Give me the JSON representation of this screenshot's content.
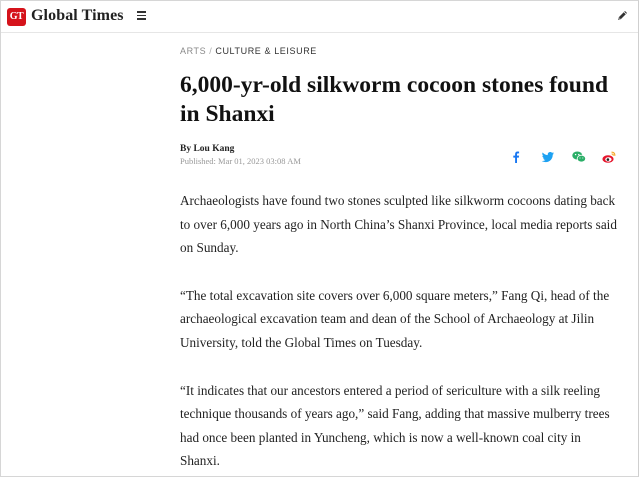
{
  "site": {
    "logo_badge": "GT",
    "name": "Global Times"
  },
  "icons": {
    "menu": "hamburger-menu-icon",
    "edit": "edit-pen-icon",
    "facebook": "facebook-icon",
    "twitter": "twitter-icon",
    "wechat": "wechat-icon",
    "weibo": "weibo-icon"
  },
  "colors": {
    "brand_red": "#d5131b",
    "share_blue": "#1877f2",
    "twitter_blue": "#1da1f2",
    "wechat_green": "#2aae67",
    "weibo_red": "#e6162d"
  },
  "breadcrumb": {
    "section": "ARTS",
    "separator": "/",
    "subsection": "CULTURE & LEISURE"
  },
  "article": {
    "title": "6,000-yr-old silkworm cocoon stones found in Shanxi",
    "author": "By Lou Kang",
    "published": "Published: Mar 01, 2023 03:08 AM",
    "paragraphs": [
      "Archaeologists have found two stones sculpted like silkworm cocoons dating back to over 6,000 years ago in North China’s Shanxi Province, local media reports said on Sunday.",
      "“The total excavation site covers over 6,000 square meters,” Fang Qi, head of the archaeological excavation team and dean of the School of Archaeology at Jilin University, told the Global Times on Tuesday.",
      "“It indicates that our ancestors entered a period of sericulture with a silk reeling technique thousands of years ago,” said Fang, adding that massive mulberry trees had once been planted in Yuncheng, which is now a well-known coal city in Shanxi."
    ]
  }
}
